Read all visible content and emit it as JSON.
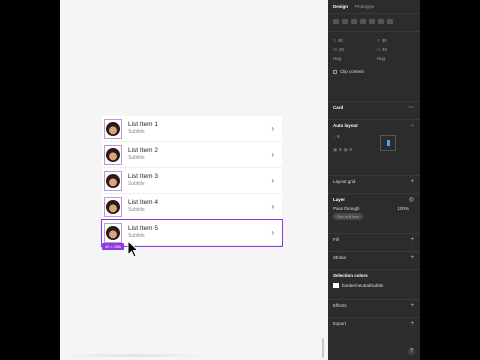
{
  "panel": {
    "tabs": [
      {
        "label": "Design"
      },
      {
        "label": "Prototype"
      }
    ],
    "position": {
      "x": "X",
      "x_val": "40",
      "y": "Y",
      "y_val": "40",
      "w": "W",
      "w_val": "40",
      "h": "H",
      "h_val": "40"
    },
    "hug_label_1": "Hug",
    "hug_label_2": "Hug",
    "clip_content": "Clip content",
    "component_name": "Card",
    "auto_layout": "Auto layout",
    "gap_val": "8",
    "pad_a": "8",
    "pad_b": "8",
    "layout_grid": "Layout grid",
    "layer": "Layer",
    "pass_through": "Pass through",
    "opacity": "100%",
    "layer_pill": "Out of 8 text",
    "fill": "Fill",
    "stroke": "Stroke",
    "selection_colors": "Selection colors",
    "selection_swatch_label": "border/neutral/subtle",
    "effects": "Effects",
    "export": "Export",
    "help": "?"
  },
  "list": {
    "items": [
      {
        "title": "List Item 1",
        "subtitle": "Subtitle"
      },
      {
        "title": "List Item 2",
        "subtitle": "Subtitle"
      },
      {
        "title": "List Item 3",
        "subtitle": "Subtitle"
      },
      {
        "title": "List Item 4",
        "subtitle": "Subtitle"
      },
      {
        "title": "List Item 5",
        "subtitle": "Subtitle"
      }
    ],
    "selection_dims": "40 × 288"
  },
  "colors": {
    "selection": "#8c39e6",
    "panel_bg": "#2c2c2c",
    "canvas_bg": "#f5f5f5"
  }
}
